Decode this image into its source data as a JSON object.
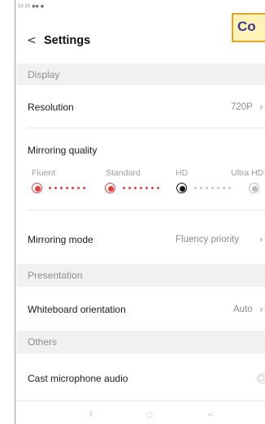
{
  "status_bar": {
    "text": "10:31 ◼◼ ●"
  },
  "header": {
    "back_glyph": "<",
    "title": "Settings"
  },
  "badge": {
    "text": "Co"
  },
  "sections": {
    "display": "Display",
    "presentation": "Presentation",
    "others": "Others"
  },
  "display": {
    "resolution": {
      "label": "Resolution",
      "value": "720P"
    },
    "mirroring_quality": {
      "label": "Mirroring quality",
      "options": [
        "Fluent",
        "Standard",
        "HD",
        "Ultra HD"
      ],
      "selected": "HD"
    },
    "mirroring_mode": {
      "label": "Mirroring mode",
      "value": "Fluency priority"
    }
  },
  "presentation": {
    "whiteboard_orientation": {
      "label": "Whiteboard orientation",
      "value": "Auto"
    }
  },
  "others": {
    "cast_microphone_audio": {
      "label": "Cast microphone audio",
      "enabled": false
    }
  },
  "colors": {
    "accent": "#e04040",
    "selected": "#111111",
    "section_bg": "#f1f1f1",
    "badge_bg": "#fff2b8",
    "badge_border": "#e0a528"
  },
  "icons": {
    "back": "chevron-left-icon",
    "row_chevron": "chevron-right-icon"
  },
  "bottom_nav": {
    "recents": "⦀",
    "home": "○",
    "back": "<"
  }
}
